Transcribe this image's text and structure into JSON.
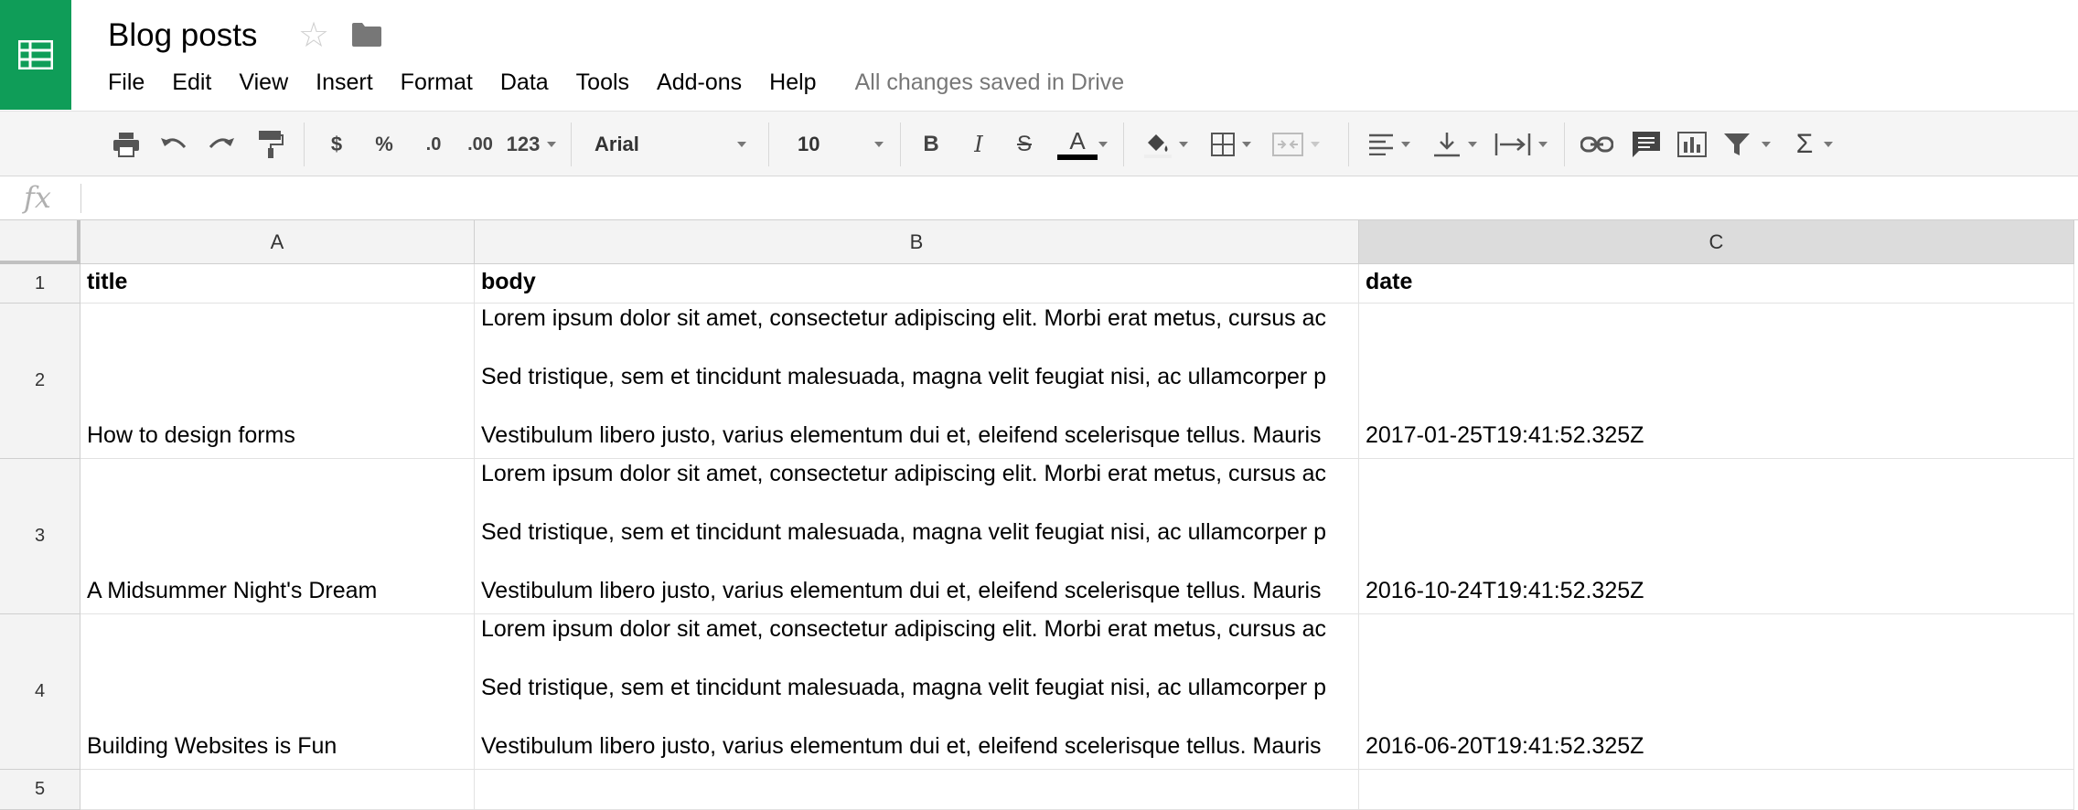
{
  "app": {
    "title": "Blog posts",
    "save_status": "All changes saved in Drive",
    "brand_color": "#0f9d58"
  },
  "menu": [
    "File",
    "Edit",
    "View",
    "Insert",
    "Format",
    "Data",
    "Tools",
    "Add-ons",
    "Help"
  ],
  "toolbar": {
    "currency": "$",
    "percent": "%",
    "decrease_decimals": ".0",
    "increase_decimals": ".00",
    "more_formats": "123",
    "font": "Arial",
    "font_size": "10",
    "bold": "B",
    "italic": "I",
    "strikethrough": "S",
    "text_color": "A",
    "sum": "Σ"
  },
  "formula_bar": {
    "fx_label": "fx",
    "value": ""
  },
  "columns": [
    "A",
    "B",
    "C"
  ],
  "row_numbers": [
    "1",
    "2",
    "3",
    "4",
    "5"
  ],
  "rows": [
    {
      "title": "title",
      "body": [
        "body"
      ],
      "date": "date"
    },
    {
      "title": "How to design forms",
      "body": [
        "Lorem ipsum dolor sit amet, consectetur adipiscing elit. Morbi erat metus, cursus ac",
        "Sed tristique, sem et tincidunt malesuada, magna velit feugiat nisi, ac ullamcorper p",
        "Vestibulum libero justo, varius elementum dui et, eleifend scelerisque tellus. Mauris"
      ],
      "date": "2017-01-25T19:41:52.325Z"
    },
    {
      "title": "A Midsummer Night's Dream",
      "body": [
        "Lorem ipsum dolor sit amet, consectetur adipiscing elit. Morbi erat metus, cursus ac",
        "Sed tristique, sem et tincidunt malesuada, magna velit feugiat nisi, ac ullamcorper p",
        "Vestibulum libero justo, varius elementum dui et, eleifend scelerisque tellus. Mauris"
      ],
      "date": "2016-10-24T19:41:52.325Z"
    },
    {
      "title": "Building Websites is Fun",
      "body": [
        "Lorem ipsum dolor sit amet, consectetur adipiscing elit. Morbi erat metus, cursus ac",
        "Sed tristique, sem et tincidunt malesuada, magna velit feugiat nisi, ac ullamcorper p",
        "Vestibulum libero justo, varius elementum dui et, eleifend scelerisque tellus. Mauris"
      ],
      "date": "2016-06-20T19:41:52.325Z"
    },
    {
      "title": "",
      "body": [
        ""
      ],
      "date": ""
    }
  ]
}
